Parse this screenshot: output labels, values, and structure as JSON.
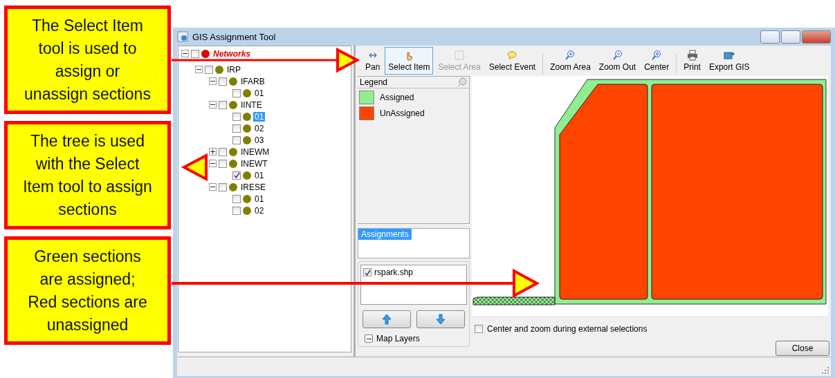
{
  "callouts": [
    "The Select Item tool is used to assign or unassign sections",
    "The tree is used with the Select Item tool to assign sections",
    "Green sections are assigned;\nRed sections are unassigned"
  ],
  "window": {
    "title": "GIS Assignment Tool"
  },
  "tree": [
    {
      "label": "Networks",
      "kind": "root",
      "color": "#e00000",
      "checked": false,
      "selected": false,
      "expanded": true,
      "children": [
        {
          "label": "IRP",
          "color": "#808000",
          "checked": false,
          "selected": false,
          "expanded": true,
          "children": [
            {
              "label": "IFARB",
              "color": "#808000",
              "checked": false,
              "selected": false,
              "expanded": true,
              "children": [
                {
                  "label": "01",
                  "color": "#808000",
                  "checked": false,
                  "selected": false
                }
              ]
            },
            {
              "label": "IINTE",
              "color": "#808000",
              "checked": false,
              "selected": false,
              "expanded": true,
              "children": [
                {
                  "label": "01",
                  "color": "#808000",
                  "checked": false,
                  "selected": true
                },
                {
                  "label": "02",
                  "color": "#808000",
                  "checked": false,
                  "selected": false
                },
                {
                  "label": "03",
                  "color": "#808000",
                  "checked": false,
                  "selected": false
                }
              ]
            },
            {
              "label": "INEWM",
              "color": "#808000",
              "checked": false,
              "selected": false,
              "expanded": false
            },
            {
              "label": "INEWT",
              "color": "#808000",
              "checked": false,
              "selected": false,
              "expanded": true,
              "children": [
                {
                  "label": "01",
                  "color": "#808000",
                  "checked": true,
                  "selected": false
                }
              ]
            },
            {
              "label": "IRESE",
              "color": "#808000",
              "checked": false,
              "selected": false,
              "expanded": true,
              "children": [
                {
                  "label": "01",
                  "color": "#808000",
                  "checked": false,
                  "selected": false
                },
                {
                  "label": "02",
                  "color": "#808000",
                  "checked": false,
                  "selected": false
                }
              ]
            }
          ]
        }
      ]
    }
  ],
  "toolbar": {
    "groups": [
      [
        {
          "label": "Pan",
          "selected": false,
          "disabled": false
        },
        {
          "label": "Select Item",
          "selected": true,
          "disabled": false
        },
        {
          "label": "Select Area",
          "selected": false,
          "disabled": true
        },
        {
          "label": "Select Event",
          "selected": false,
          "disabled": false
        }
      ],
      [
        {
          "label": "Zoom Area",
          "selected": false,
          "disabled": false
        },
        {
          "label": "Zoom Out",
          "selected": false,
          "disabled": false
        },
        {
          "label": "Center",
          "selected": false,
          "disabled": false
        }
      ],
      [
        {
          "label": "Print",
          "selected": false,
          "disabled": false
        },
        {
          "label": "Export GIS",
          "selected": false,
          "disabled": false
        }
      ]
    ]
  },
  "legend": {
    "title": "Legend",
    "items": [
      {
        "label": "Assigned",
        "color": "#90ee90"
      },
      {
        "label": "UnAssigned",
        "color": "#ff4500"
      }
    ]
  },
  "assignments": {
    "title": "Assignments"
  },
  "layers": {
    "items": [
      {
        "label": "rspark.shp",
        "checked": true
      }
    ],
    "title": "Map Layers",
    "expanded": true
  },
  "center_zoom": {
    "label": "Center and zoom during external selections",
    "checked": false
  },
  "close_button": "Close"
}
